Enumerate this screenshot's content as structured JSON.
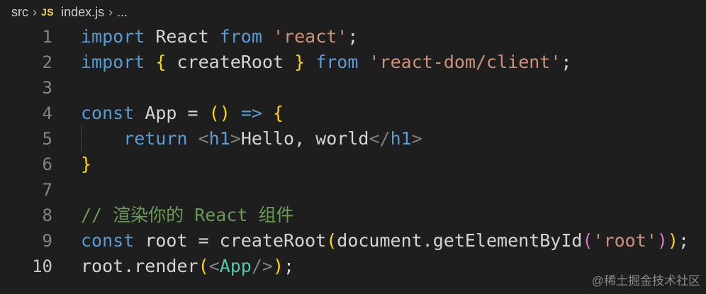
{
  "breadcrumb": {
    "folder": "src",
    "file_badge": "JS",
    "file": "index.js",
    "ellipsis": "..."
  },
  "editor": {
    "line_numbers": [
      "1",
      "2",
      "3",
      "4",
      "5",
      "6",
      "7",
      "8",
      "9",
      "10"
    ],
    "current_line": "10",
    "lines": [
      {
        "tokens": [
          [
            "kw",
            "import"
          ],
          [
            "plain",
            " "
          ],
          [
            "plain",
            "React"
          ],
          [
            "plain",
            " "
          ],
          [
            "kw",
            "from"
          ],
          [
            "plain",
            " "
          ],
          [
            "str",
            "'react'"
          ],
          [
            "plain",
            ";"
          ]
        ]
      },
      {
        "tokens": [
          [
            "kw",
            "import"
          ],
          [
            "plain",
            " "
          ],
          [
            "brace",
            "{"
          ],
          [
            "plain",
            " "
          ],
          [
            "plain",
            "createRoot"
          ],
          [
            "plain",
            " "
          ],
          [
            "brace",
            "}"
          ],
          [
            "plain",
            " "
          ],
          [
            "kw",
            "from"
          ],
          [
            "plain",
            " "
          ],
          [
            "str",
            "'react-dom/client'"
          ],
          [
            "plain",
            ";"
          ]
        ]
      },
      {
        "tokens": []
      },
      {
        "tokens": [
          [
            "kw",
            "const"
          ],
          [
            "plain",
            " "
          ],
          [
            "plain",
            "App"
          ],
          [
            "plain",
            " = "
          ],
          [
            "brace",
            "()"
          ],
          [
            "plain",
            " "
          ],
          [
            "kw",
            "=>"
          ],
          [
            "plain",
            " "
          ],
          [
            "brace",
            "{"
          ]
        ]
      },
      {
        "tokens": [
          [
            "plain",
            "    "
          ],
          [
            "kw",
            "return"
          ],
          [
            "plain",
            " "
          ],
          [
            "tagpunct",
            "<"
          ],
          [
            "tag",
            "h1"
          ],
          [
            "tagpunct",
            ">"
          ],
          [
            "plain",
            "Hello, world"
          ],
          [
            "tagpunct",
            "</"
          ],
          [
            "tag",
            "h1"
          ],
          [
            "tagpunct",
            ">"
          ]
        ]
      },
      {
        "tokens": [
          [
            "brace",
            "}"
          ]
        ]
      },
      {
        "tokens": []
      },
      {
        "tokens": [
          [
            "comment",
            "// 渲染你的 React 组件"
          ]
        ]
      },
      {
        "tokens": [
          [
            "kw",
            "const"
          ],
          [
            "plain",
            " root = createRoot"
          ],
          [
            "brace",
            "("
          ],
          [
            "plain",
            "document.getElementById"
          ],
          [
            "brace2",
            "("
          ],
          [
            "str",
            "'root'"
          ],
          [
            "brace2",
            ")"
          ],
          [
            "brace",
            ")"
          ],
          [
            "plain",
            ";"
          ]
        ]
      },
      {
        "tokens": [
          [
            "plain",
            "root.render"
          ],
          [
            "brace",
            "("
          ],
          [
            "tagpunct",
            "<"
          ],
          [
            "comp",
            "App"
          ],
          [
            "tagpunct",
            "/>"
          ],
          [
            "brace",
            ")"
          ],
          [
            "plain",
            ";"
          ]
        ]
      }
    ]
  },
  "watermark": "@稀土掘金技术社区",
  "colors": {
    "background": "#1e1e1e",
    "keyword": "#569cd6",
    "string": "#ce9178",
    "bracket_level1": "#ffd700",
    "bracket_level2": "#da70d6",
    "comment": "#6a9955",
    "component": "#4ec9b0"
  }
}
